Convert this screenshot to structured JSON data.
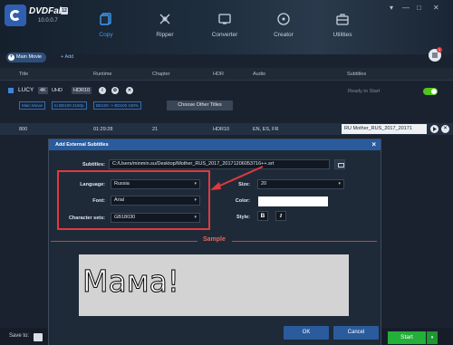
{
  "app": {
    "name": "DVDFab",
    "version": "10.0.0.7",
    "version_badge": "12",
    "accent": "#3d9bf0"
  },
  "nav": [
    {
      "label": "Copy",
      "icon": "copy-disc-icon",
      "active": true
    },
    {
      "label": "Ripper",
      "icon": "ripper-icon",
      "active": false
    },
    {
      "label": "Converter",
      "icon": "converter-icon",
      "active": false
    },
    {
      "label": "Creator",
      "icon": "creator-icon",
      "active": false
    },
    {
      "label": "Utilities",
      "icon": "toolbox-icon",
      "active": false
    }
  ],
  "toolbar": {
    "main_movie_label": "Main Movie",
    "add_label": "Add",
    "menu_badge": "1"
  },
  "columns": {
    "title": "Title",
    "runtime": "Runtime",
    "chapter": "Chapter",
    "hdr": "HDR",
    "audio": "Audio",
    "subtitles": "Subtitles"
  },
  "title_row": {
    "name": "LUCY",
    "chips": [
      "4K",
      "UHD",
      "HDR10"
    ],
    "status": "Ready to Start",
    "tags": [
      "Main Movie",
      "to BD100 2160p",
      "BD100 -> BD100 100%"
    ],
    "other_titles_label": "Choose Other Titles",
    "toggle_color": "#52c41a"
  },
  "data_row": {
    "title": "800",
    "runtime": "01:29:28",
    "chapter": "21",
    "hdr": "HDR10",
    "audio": "EN, ES, FR",
    "subtitle_selected": "RU Mother_RUS_2017_20171"
  },
  "dialog": {
    "title": "Add External Subtitles",
    "subtitles_label": "Subtitles:",
    "subtitles_path": "C:/Users/minmin.su/Desktop/Mother_RUS_2017_20171206053716++.srt",
    "language_label": "Language:",
    "language_value": "Russia",
    "font_label": "Font:",
    "font_value": "Arial",
    "charset_label": "Character sets:",
    "charset_value": "GB18030",
    "size_label": "Size:",
    "size_value": "20",
    "color_label": "Color:",
    "color_value": "#ffffff",
    "style_label": "Style:",
    "bold_label": "B",
    "italic_label": "I",
    "sample_label": "Sample",
    "sample_text": "Мама!",
    "ok_label": "OK",
    "cancel_label": "Cancel",
    "highlight_color": "#e0393e"
  },
  "bottom": {
    "save_to_label": "Save to:",
    "start_label": "Start",
    "start_color": "#23b03a"
  }
}
